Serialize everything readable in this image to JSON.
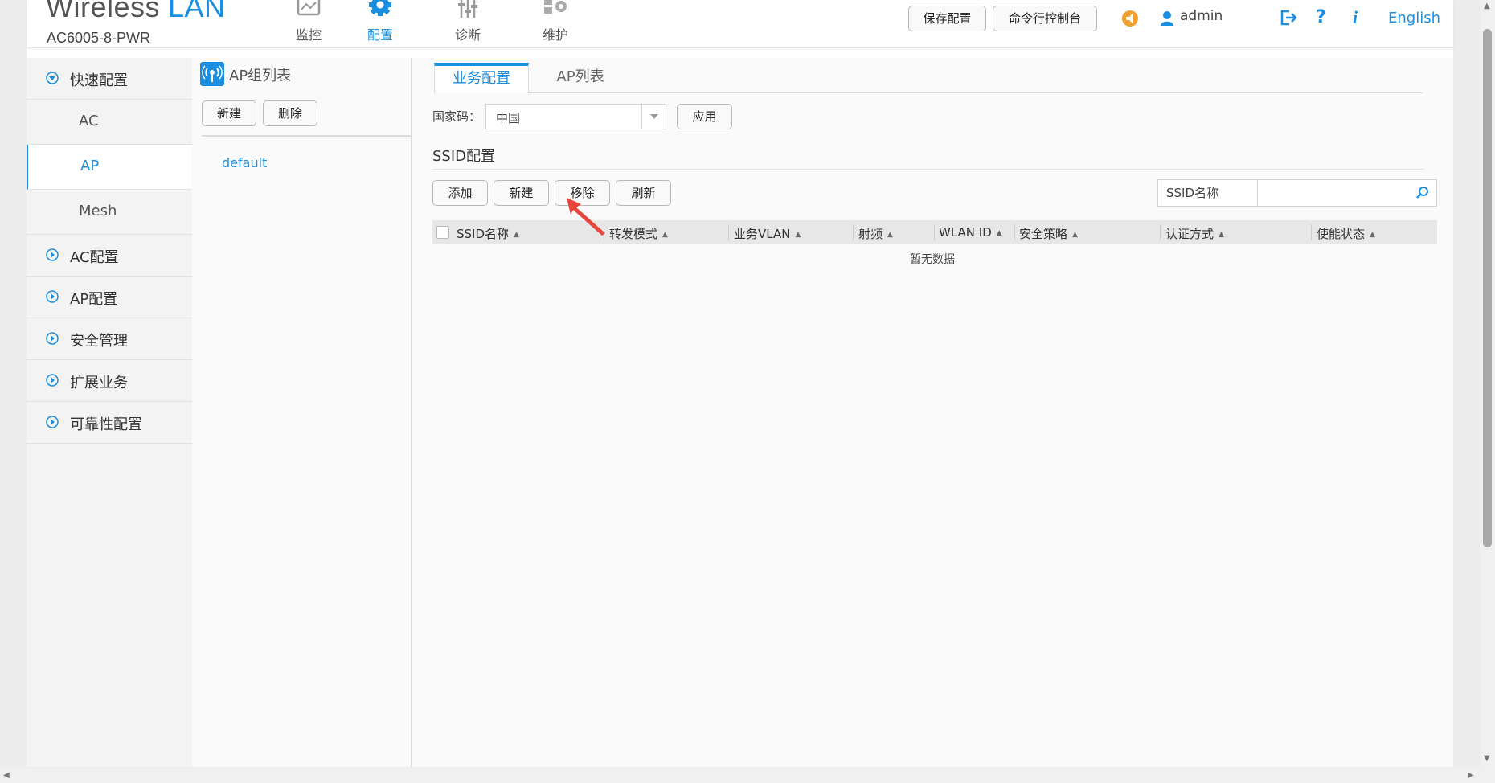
{
  "brand": {
    "title_main": "Wireless",
    "title_accent": "LAN",
    "model": "AC6005-8-PWR"
  },
  "nav": [
    {
      "label": "监控",
      "icon": "monitor-icon"
    },
    {
      "label": "配置",
      "icon": "gear-icon"
    },
    {
      "label": "诊断",
      "icon": "diagnose-icon"
    },
    {
      "label": "维护",
      "icon": "maintain-icon"
    }
  ],
  "header": {
    "save_label": "保存配置",
    "cli_label": "命令行控制台",
    "username": "admin",
    "language": "English"
  },
  "sidebar": {
    "quick_config": "快速配置",
    "sub_items": [
      "AC",
      "AP",
      "Mesh"
    ],
    "active_sub": "AP",
    "groups": [
      "AC配置",
      "AP配置",
      "安全管理",
      "扩展业务",
      "可靠性配置"
    ]
  },
  "ap_group": {
    "title": "AP组列表",
    "new_label": "新建",
    "delete_label": "删除",
    "items": [
      "default"
    ]
  },
  "main": {
    "tabs": [
      "业务配置",
      "AP列表"
    ],
    "country_label": "国家码：",
    "country_value": "中国",
    "apply_label": "应用",
    "ssid_title": "SSID配置",
    "buttons": [
      "添加",
      "新建",
      "移除",
      "刷新"
    ],
    "search_label": "SSID名称",
    "search_placeholder": "",
    "columns": [
      "SSID名称",
      "转发模式",
      "业务VLAN",
      "射频",
      "WLAN ID",
      "安全策略",
      "认证方式",
      "使能状态"
    ],
    "empty_text": "暂无数据"
  },
  "colors": {
    "accent": "#1a8ee0",
    "annotation": "#e8453c",
    "warning": "#f0a030"
  }
}
